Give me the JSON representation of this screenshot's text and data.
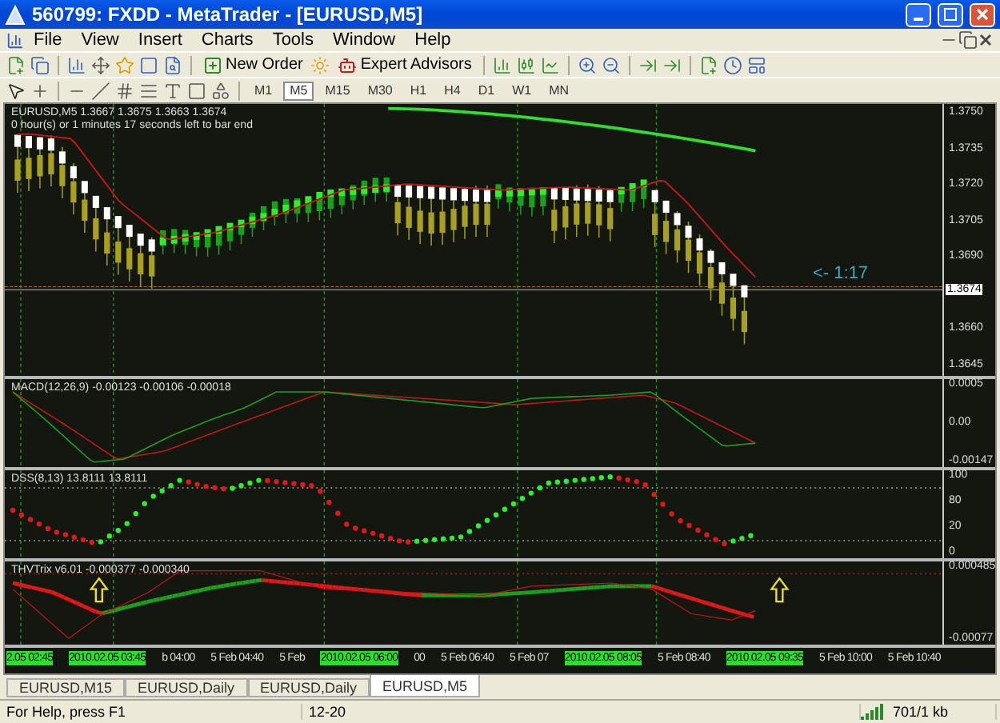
{
  "window": {
    "title": "560799: FXDD - MetaTrader - [EURUSD,M5]"
  },
  "menu": [
    "File",
    "View",
    "Insert",
    "Charts",
    "Tools",
    "Window",
    "Help"
  ],
  "toolbar": {
    "buttons": [
      {
        "label": "New Order"
      },
      {
        "label": "Expert Advisors"
      }
    ],
    "timeframes": [
      {
        "label": "M1",
        "selected": false
      },
      {
        "label": "M5",
        "selected": true
      },
      {
        "label": "M15",
        "selected": false
      },
      {
        "label": "M30",
        "selected": false
      },
      {
        "label": "H1",
        "selected": false
      },
      {
        "label": "H4",
        "selected": false
      },
      {
        "label": "D1",
        "selected": false
      },
      {
        "label": "W1",
        "selected": false
      },
      {
        "label": "MN",
        "selected": false
      }
    ]
  },
  "chart": {
    "symbol_line": "EURUSD,M5  1.3667 1.3675 1.3663 1.3674",
    "timer_line": "0 hour(s) or 1 minutes 17 seconds left to bar end",
    "countdown": "<- 1:17",
    "current_price": "1.3674",
    "price_scale": [
      "1.3750",
      "1.3735",
      "1.3720",
      "1.3705",
      "1.3690",
      "1.3660",
      "1.3645"
    ],
    "panes": [
      {
        "kind": "macd",
        "header": "MACD(12,26,9) -0.00123 -0.00106 -0.00018",
        "scale": [
          "0.0005",
          "0.00",
          "-0.00147"
        ]
      },
      {
        "kind": "dss",
        "header": "DSS(8,13) 13.8111 13.8111",
        "scale": [
          "100",
          "80",
          "20",
          "0"
        ]
      },
      {
        "kind": "trix",
        "header": "THVTrix v6.01 -0.000377 -0.000340",
        "scale": [
          "0.000485",
          "-0.00077"
        ]
      }
    ],
    "time_axis": [
      {
        "label": "2.05 02:45",
        "highlighted": true
      },
      {
        "label": "2010.02.05 03:45",
        "highlighted": true
      },
      {
        "label": "b 04:00",
        "highlighted": false
      },
      {
        "label": "5 Feb 04:40",
        "highlighted": false
      },
      {
        "label": "5 Feb",
        "highlighted": false
      },
      {
        "label": "2010.02.05 06:00",
        "highlighted": true
      },
      {
        "label": "00",
        "highlighted": false
      },
      {
        "label": "5 Feb 06:40",
        "highlighted": false
      },
      {
        "label": "5 Feb 07",
        "highlighted": false
      },
      {
        "label": "2010.02.05 08:05",
        "highlighted": true
      },
      {
        "label": "5 Feb 08:40",
        "highlighted": false
      },
      {
        "label": "2010.02.05 09:35",
        "highlighted": true
      },
      {
        "label": "5 Feb 10:00",
        "highlighted": false
      },
      {
        "label": "5 Feb 10:40",
        "highlighted": false
      }
    ]
  },
  "tabs": [
    {
      "label": "EURUSD,M15",
      "selected": false
    },
    {
      "label": "EURUSD,Daily",
      "selected": false
    },
    {
      "label": "EURUSD,Daily",
      "selected": false
    },
    {
      "label": "EURUSD,M5",
      "selected": true
    }
  ],
  "status_bar": [
    "For Help, press F1",
    "12-20",
    "701/1 kb"
  ]
}
